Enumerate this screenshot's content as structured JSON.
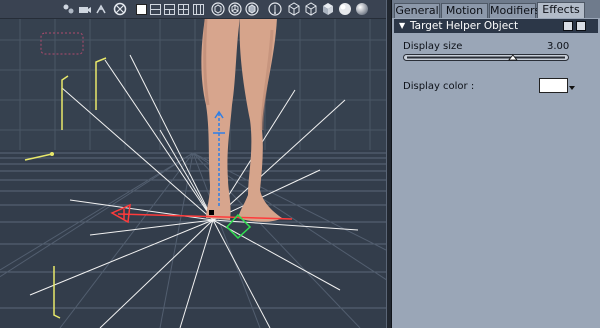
{
  "panel": {
    "tabs": [
      {
        "label": "General",
        "active": false
      },
      {
        "label": "Motion",
        "active": false
      },
      {
        "label": "Modifiers",
        "active": false
      },
      {
        "label": "Effects",
        "active": true
      }
    ],
    "section_title": "Target Helper Object",
    "display_size_label": "Display size",
    "display_size_value": "3.00",
    "display_size_slider": 0.67,
    "display_color_label": "Display color :",
    "display_color": "#ffffff"
  },
  "toolbar": {
    "icons": [
      "lights-icon",
      "camera-icon",
      "bones-icon",
      "grid-display-icon",
      "single-view-icon",
      "two-view-icon",
      "three-view-icon",
      "four-view-icon",
      "move-helper-icon",
      "rotate-helper-icon",
      "scale-helper-icon",
      "wireframe-icon",
      "outline-box-icon",
      "box-icon",
      "solid-sphere-icon",
      "shaded-sphere-icon"
    ]
  },
  "colors": {
    "viewport_bg": "#35404f",
    "panel_bg": "#9aa6b7",
    "header_bg": "#2c3748",
    "x_axis": "#ff3b3b",
    "y_axis": "#2f7fe6",
    "z_axis": "#30e050",
    "light_lines": "#ffffff",
    "guide_lines": "#e8e86a"
  }
}
